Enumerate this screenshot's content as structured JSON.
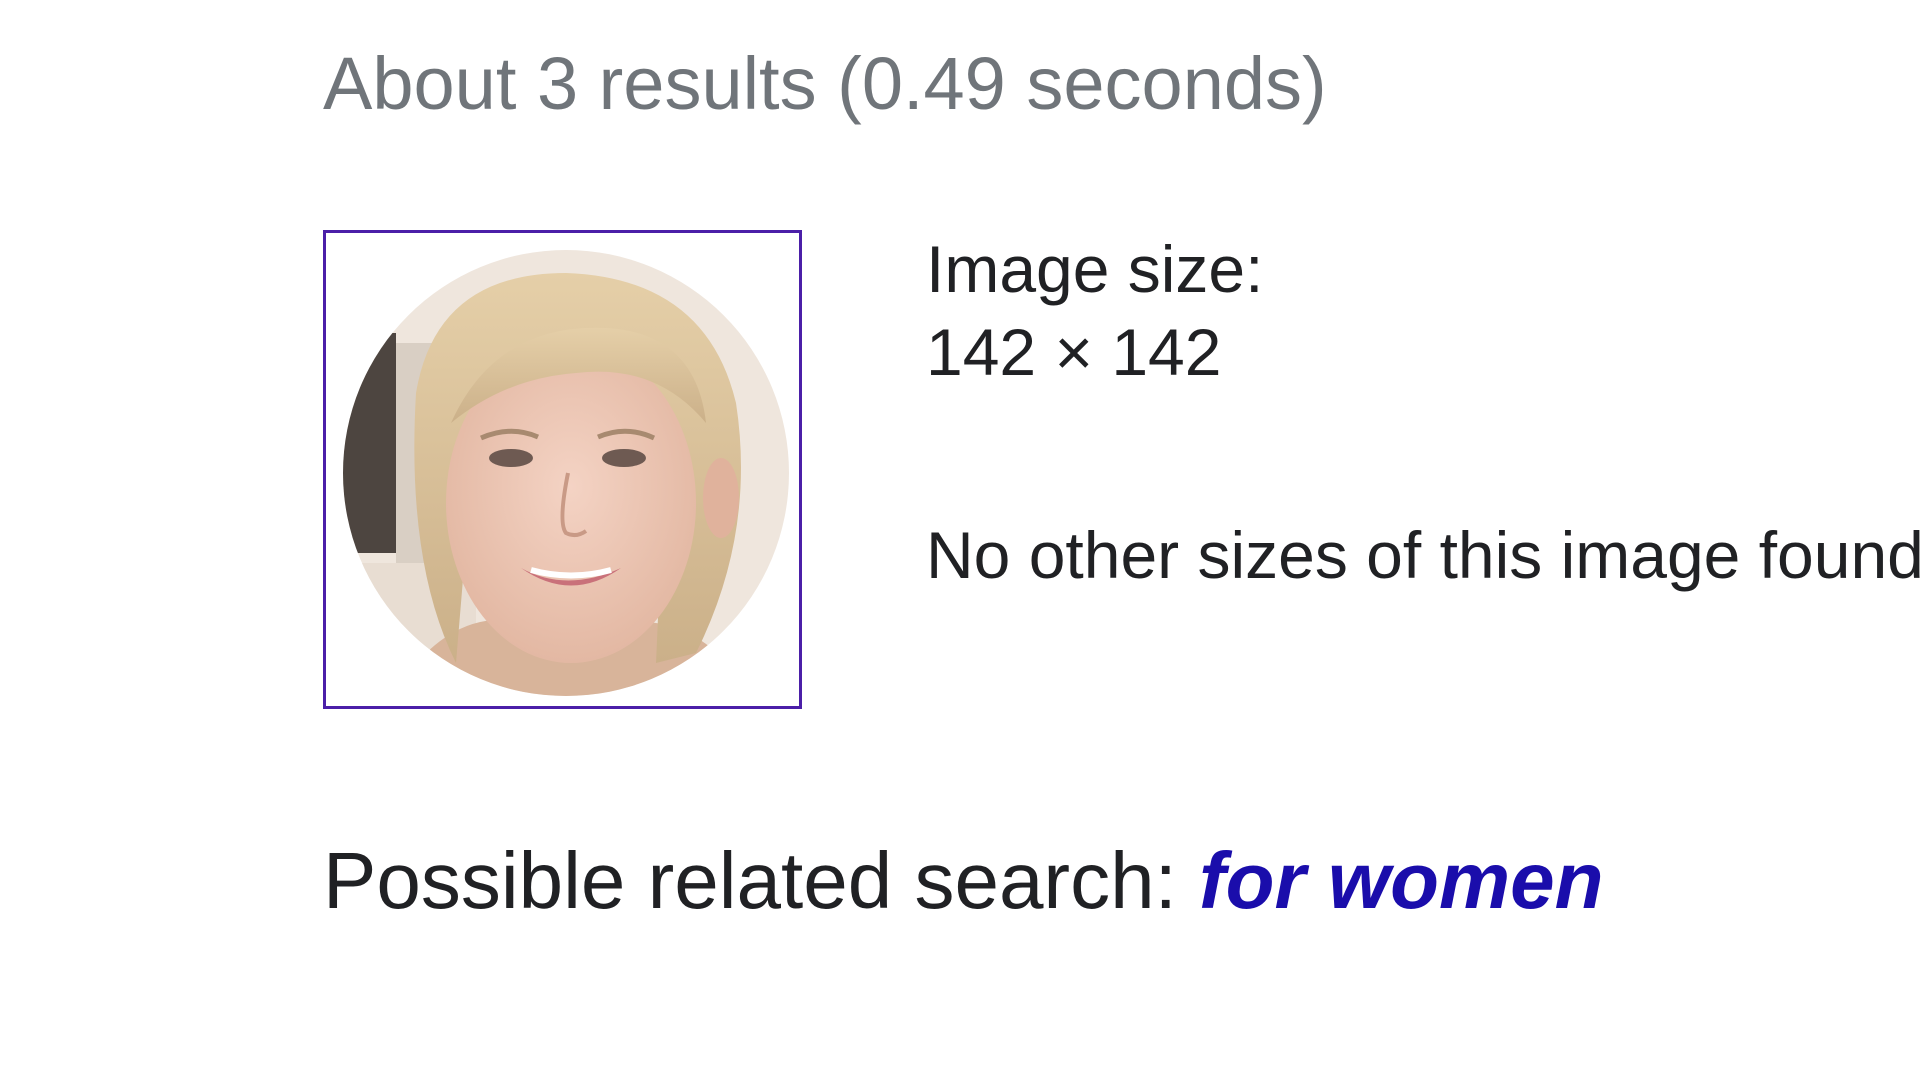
{
  "results": {
    "stats_text": "About 3 results (0.49 seconds)"
  },
  "image_info": {
    "size_label": "Image size:",
    "size_value": "142 × 142",
    "no_other_sizes": "No other sizes of this image found."
  },
  "related_search": {
    "prefix": "Possible related search: ",
    "query": "for women"
  },
  "colors": {
    "thumbnail_border": "#4b1fa8",
    "link": "#1a0dab",
    "stats_text": "#70757a",
    "body_text": "#202124"
  }
}
